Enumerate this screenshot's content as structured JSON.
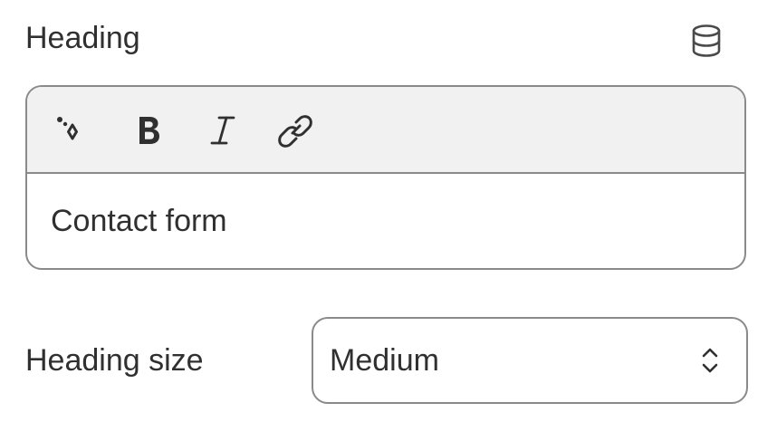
{
  "heading_field": {
    "label": "Heading",
    "source_icon": "database-icon",
    "toolbar": [
      {
        "name": "ai-sparkle-icon"
      },
      {
        "name": "bold-icon"
      },
      {
        "name": "italic-icon"
      },
      {
        "name": "link-icon"
      }
    ],
    "value": "Contact form"
  },
  "heading_size": {
    "label": "Heading size",
    "selected": "Medium",
    "chevron_icon": "select-chevron-icon"
  },
  "colors": {
    "text": "#303030",
    "border": "#8a8a8a",
    "toolbar_bg": "#f1f1f1"
  }
}
